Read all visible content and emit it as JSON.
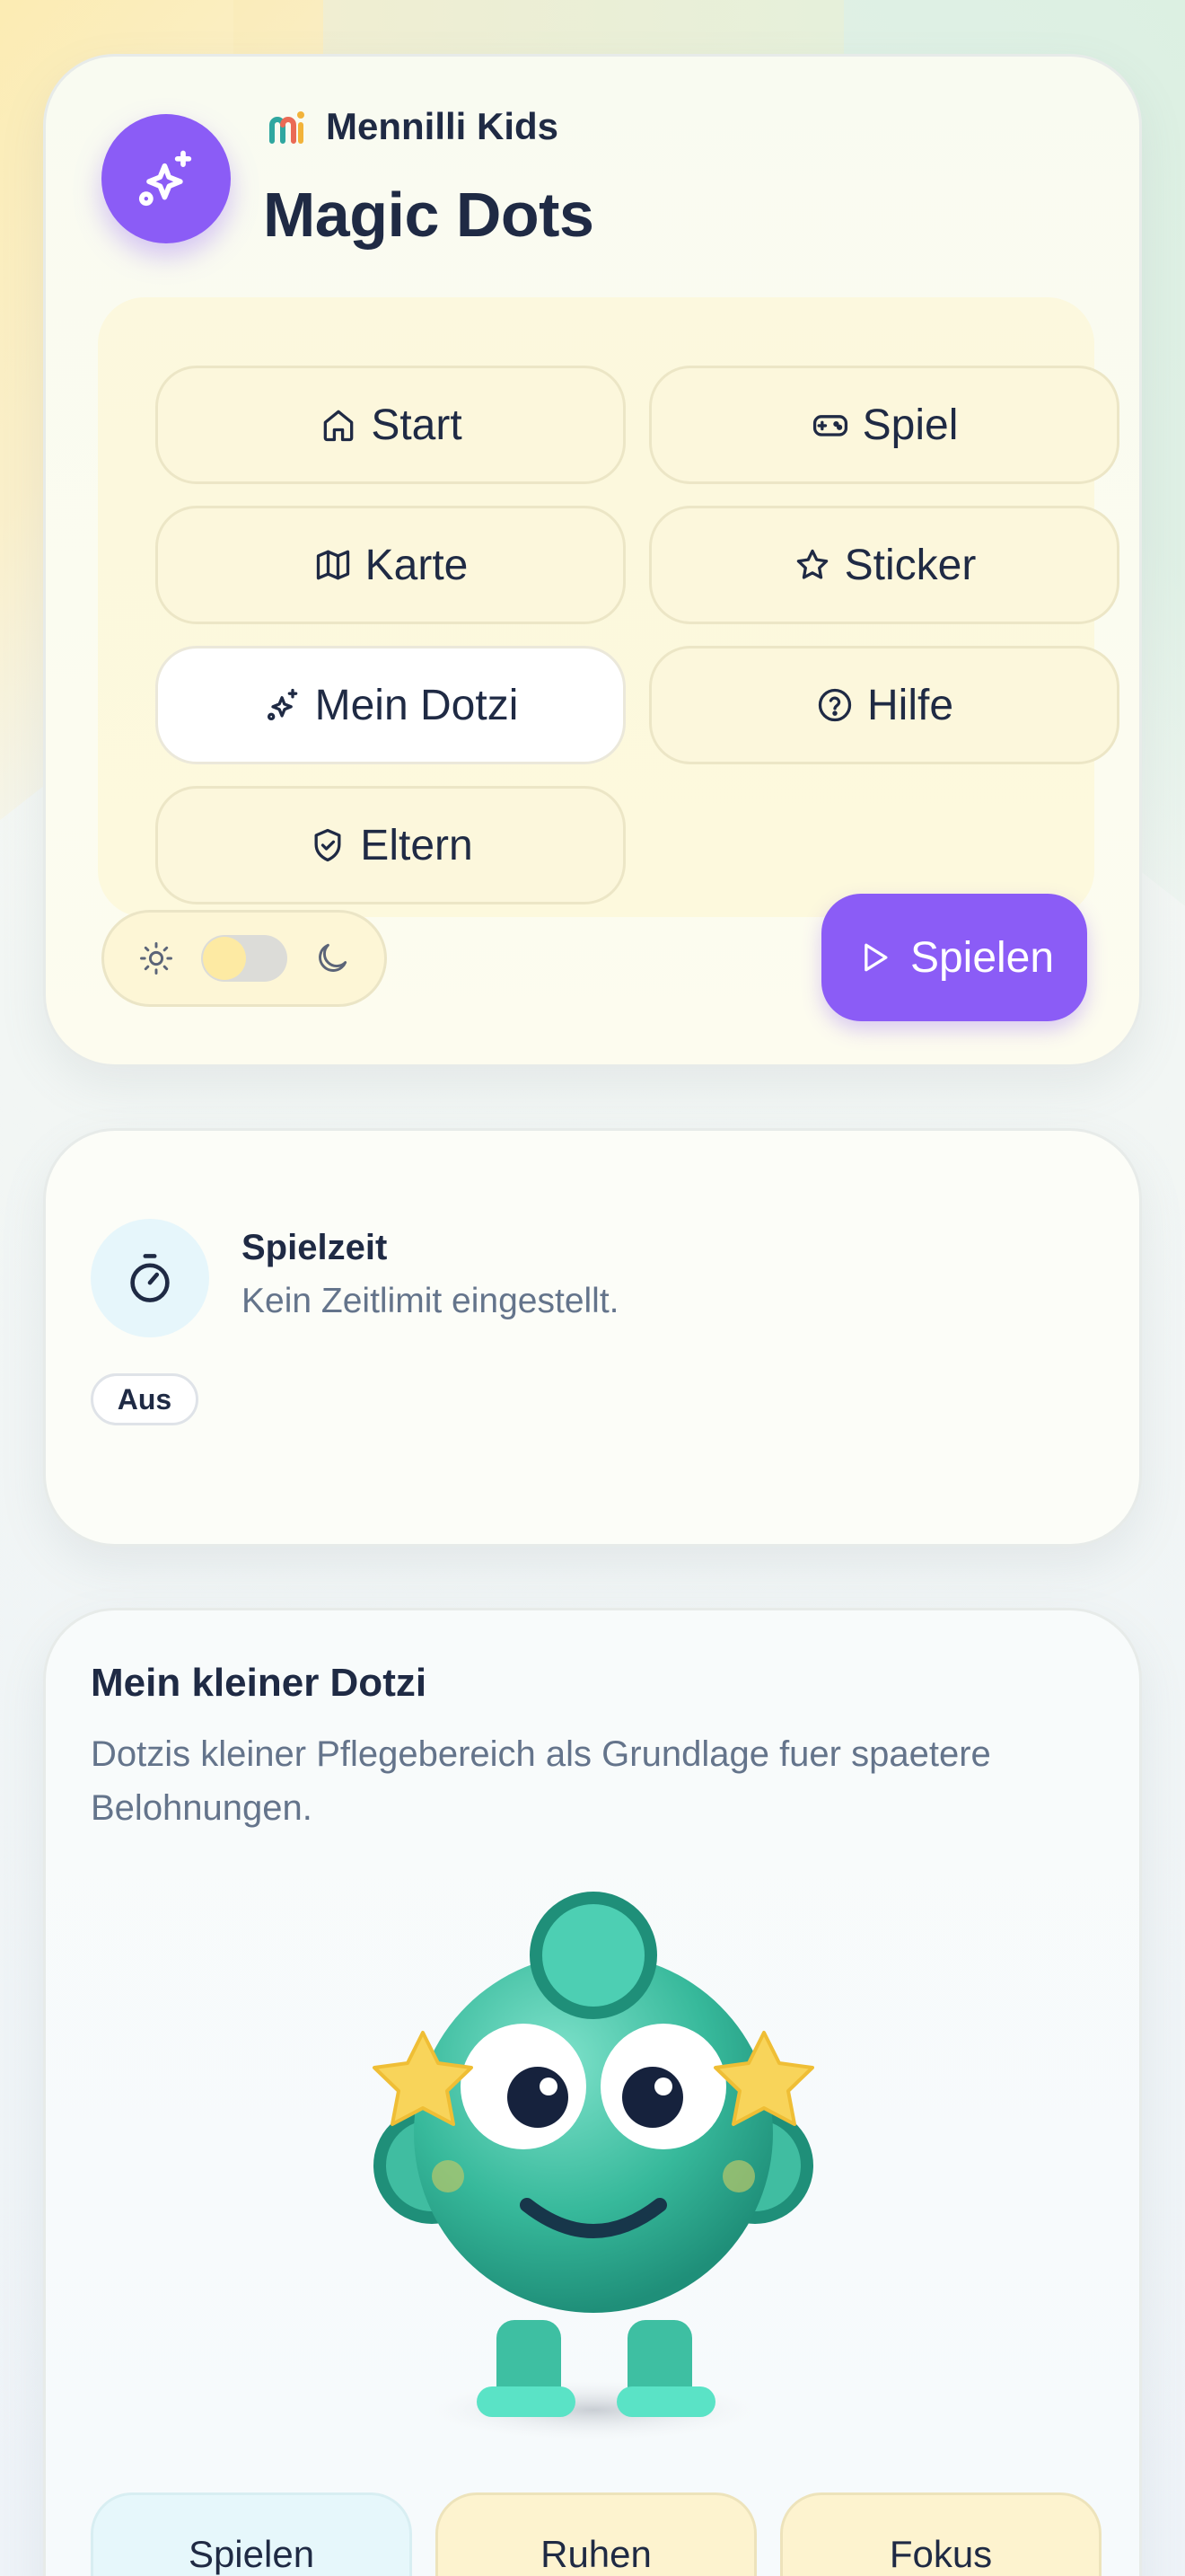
{
  "brand": {
    "name": "Mennilli Kids"
  },
  "app": {
    "title": "Magic Dots"
  },
  "nav": {
    "items": [
      {
        "label": "Start",
        "icon": "home-icon"
      },
      {
        "label": "Spiel",
        "icon": "gamepad-icon"
      },
      {
        "label": "Karte",
        "icon": "map-icon"
      },
      {
        "label": "Sticker",
        "icon": "star-icon"
      },
      {
        "label": "Mein Dotzi",
        "icon": "sparkles-icon",
        "active": true
      },
      {
        "label": "Hilfe",
        "icon": "help-circle-icon"
      },
      {
        "label": "Eltern",
        "icon": "shield-check-icon"
      }
    ]
  },
  "theme": {
    "mode": "light"
  },
  "play": {
    "label": "Spielen"
  },
  "playtime": {
    "title": "Spielzeit",
    "subtitle": "Kein Zeitlimit eingestellt.",
    "badge": "Aus"
  },
  "dotzi": {
    "title": "Mein kleiner Dotzi",
    "description": "Dotzis kleiner Pflegebereich als Grundlage fuer spaetere Belohnungen.",
    "moods": [
      {
        "label": "Spielen",
        "active": true
      },
      {
        "label": "Ruhen"
      },
      {
        "label": "Fokus"
      }
    ]
  },
  "colors": {
    "accent": "#8b5cf6",
    "text": "#1f2a44",
    "muted": "#64748b",
    "mascot": "#3cc1a5"
  }
}
